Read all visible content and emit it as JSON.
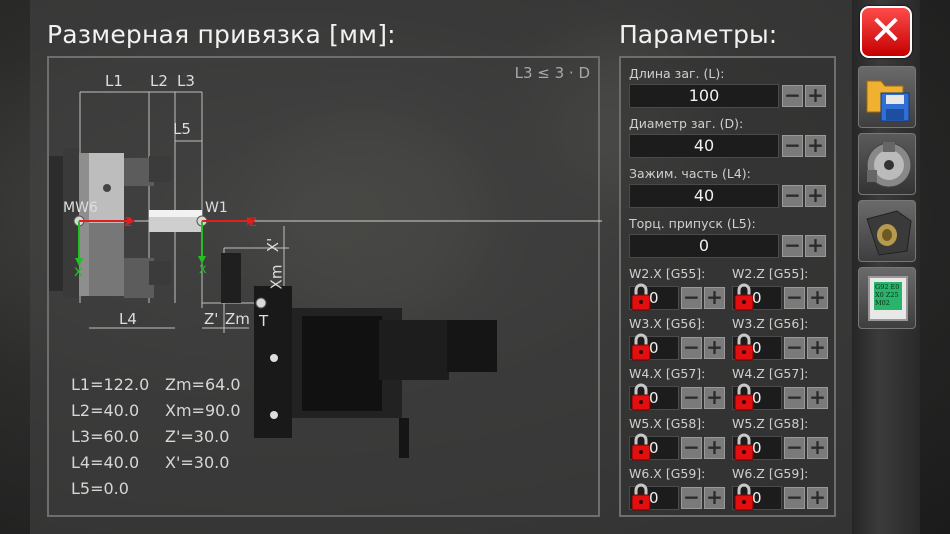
{
  "header": {
    "title": "Размерная привязка [мм]:",
    "params_title": "Параметры:"
  },
  "diagram": {
    "condition": "L3 ≤ 3 · D",
    "labels": {
      "L1": "L1",
      "L2": "L2",
      "L3": "L3",
      "L4": "L4",
      "L5": "L5",
      "MW6": "MW6",
      "W1": "W1",
      "Xprime": "X'",
      "Xm": "Xm",
      "Zprime": "Z'",
      "Zm": "Zm",
      "T": "T",
      "z_left": "z",
      "z_right": "z",
      "x_left": "x",
      "x_right": "x"
    },
    "values_left": [
      "L1=122.0",
      "L2=40.0",
      "L3=60.0",
      "L4=40.0",
      "L5=0.0"
    ],
    "values_right": [
      "Zm=64.0",
      "Xm=90.0",
      "Z'=30.0",
      "X'=30.0"
    ]
  },
  "params": {
    "length": {
      "label": "Длина заг. (L):",
      "value": "100"
    },
    "diameter": {
      "label": "Диаметр заг. (D):",
      "value": "40"
    },
    "clamp": {
      "label": "Зажим. часть (L4):",
      "value": "40"
    },
    "facing": {
      "label": "Торц. припуск (L5):",
      "value": "0"
    },
    "minus": "−",
    "plus": "+",
    "offsets": [
      {
        "left_label": "W2.X [G55]:",
        "left_value": "0",
        "right_label": "W2.Z [G55]:",
        "right_value": "0"
      },
      {
        "left_label": "W3.X [G56]:",
        "left_value": "0",
        "right_label": "W3.Z [G56]:",
        "right_value": "0"
      },
      {
        "left_label": "W4.X [G57]:",
        "left_value": "0",
        "right_label": "W4.Z [G57]:",
        "right_value": "0"
      },
      {
        "left_label": "W5.X [G58]:",
        "left_value": "0",
        "right_label": "W5.Z [G58]:",
        "right_value": "0"
      },
      {
        "left_label": "W6.X [G59]:",
        "left_value": "0",
        "right_label": "W6.Z [G59]:",
        "right_value": "0"
      }
    ]
  },
  "toolbar": {
    "close_glyph": "✕",
    "gcode_text": "G92 E0\nX0 Z25\nM02",
    "items": [
      "close-icon",
      "open-save-icon",
      "chuck-icon",
      "tailstock-icon",
      "gcode-icon"
    ]
  },
  "colors": {
    "axis_z": "#e02020",
    "axis_x": "#22c022",
    "lock_red": "#e01010",
    "close_red": "#e01818"
  }
}
